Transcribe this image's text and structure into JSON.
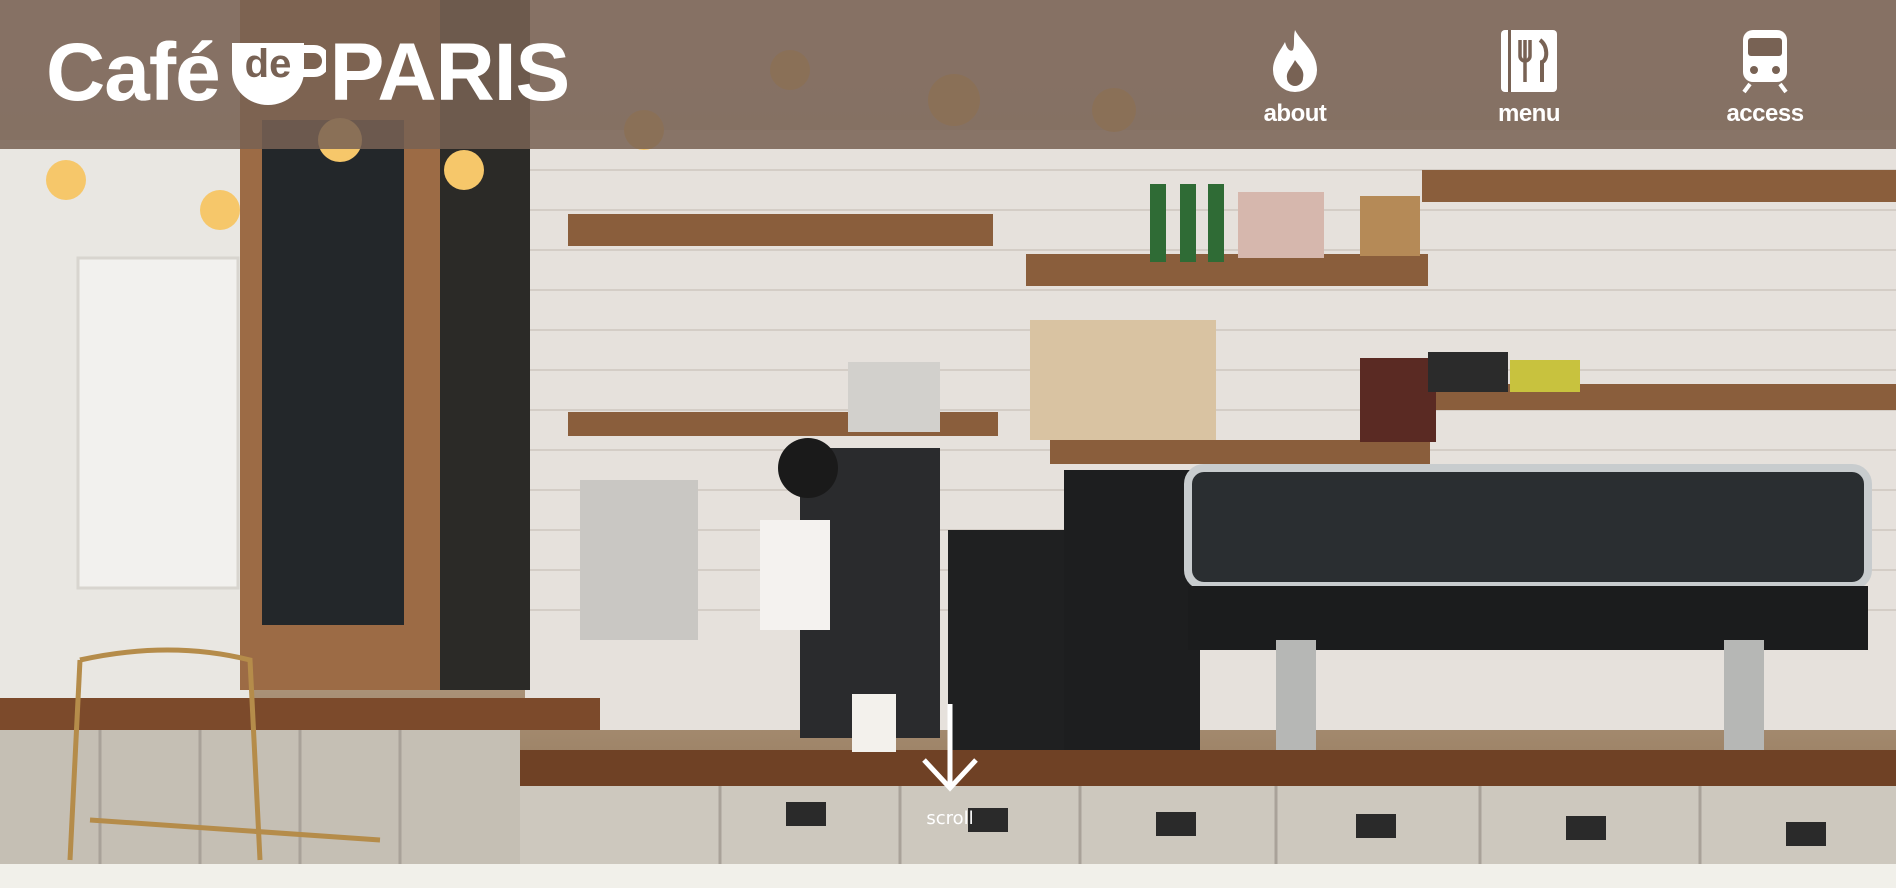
{
  "brand": {
    "word_left": "Café",
    "cup_text": "de",
    "word_right": "PARIS"
  },
  "nav": [
    {
      "label": "about",
      "icon": "flame-icon"
    },
    {
      "label": "menu",
      "icon": "fork-knife-icon"
    },
    {
      "label": "access",
      "icon": "train-icon"
    }
  ],
  "scroll": {
    "label": "scroll",
    "icon": "arrow-down-icon"
  },
  "colors": {
    "header_overlay": "#786254",
    "text": "#ffffff",
    "page_background": "#f1f0ea"
  }
}
